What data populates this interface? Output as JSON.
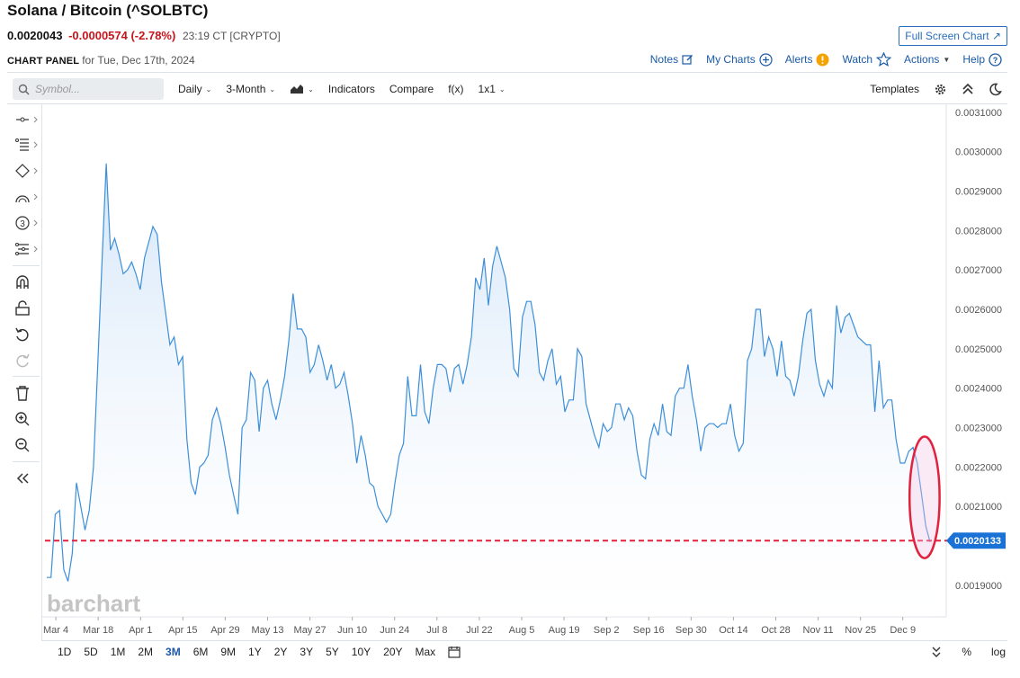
{
  "header": {
    "title": "Solana / Bitcoin (^SOLBTC)",
    "price": "0.0020043",
    "change": "-0.0000574 (-2.78%)",
    "time": "23:19 CT [CRYPTO]",
    "fullscreen_label": "Full Screen Chart ↗",
    "panel_label": "CHART PANEL",
    "panel_date": "for Tue, Dec 17th, 2024"
  },
  "top_links": {
    "notes": "Notes",
    "my_charts": "My Charts",
    "alerts": "Alerts",
    "watch": "Watch",
    "actions": "Actions",
    "help": "Help"
  },
  "toolbar": {
    "search_placeholder": "Symbol...",
    "interval": "Daily",
    "range": "3-Month",
    "indicators": "Indicators",
    "compare": "Compare",
    "fx": "f(x)",
    "layout": "1x1",
    "templates": "Templates"
  },
  "bottom_ranges": [
    "1D",
    "5D",
    "1M",
    "2M",
    "3M",
    "6M",
    "9M",
    "1Y",
    "2Y",
    "3Y",
    "5Y",
    "10Y",
    "20Y",
    "Max"
  ],
  "active_range": "3M",
  "bottom_right": {
    "percent": "%",
    "log": "log"
  },
  "watermark": "barchart",
  "colors": {
    "line": "#3d8fd9",
    "fill": "#d9eafb",
    "price_line": "#e0223f",
    "badge": "#1b72d6",
    "highlight": "#e0223f"
  },
  "chart_data": {
    "type": "area",
    "title": "",
    "xlabel": "",
    "ylabel": "",
    "ylim": [
      0.00182,
      0.00312
    ],
    "y_ticks": [
      "0.0031000",
      "0.0030000",
      "0.0029000",
      "0.0028000",
      "0.0027000",
      "0.0026000",
      "0.0025000",
      "0.0024000",
      "0.0023000",
      "0.0022000",
      "0.0021000",
      "0.0020133",
      "0.0019000"
    ],
    "y_tick_values": [
      0.0031,
      0.003,
      0.0029,
      0.0028,
      0.0027,
      0.0026,
      0.0025,
      0.0024,
      0.0023,
      0.0022,
      0.0021,
      0.0019
    ],
    "x_ticks": [
      {
        "label": "Mar 4",
        "day": 3
      },
      {
        "label": "Mar 18",
        "day": 17
      },
      {
        "label": "Apr 1",
        "day": 31
      },
      {
        "label": "Apr 15",
        "day": 45
      },
      {
        "label": "Apr 29",
        "day": 59
      },
      {
        "label": "May 13",
        "day": 73
      },
      {
        "label": "May 27",
        "day": 87
      },
      {
        "label": "Jun 10",
        "day": 101
      },
      {
        "label": "Jun 24",
        "day": 115
      },
      {
        "label": "Jul 8",
        "day": 129
      },
      {
        "label": "Jul 22",
        "day": 143
      },
      {
        "label": "Aug 5",
        "day": 157
      },
      {
        "label": "Aug 19",
        "day": 171
      },
      {
        "label": "Sep 2",
        "day": 185
      },
      {
        "label": "Sep 16",
        "day": 199
      },
      {
        "label": "Sep 30",
        "day": 213
      },
      {
        "label": "Oct 14",
        "day": 227
      },
      {
        "label": "Oct 28",
        "day": 241
      },
      {
        "label": "Nov 11",
        "day": 255
      },
      {
        "label": "Nov 25",
        "day": 269
      },
      {
        "label": "Dec 9",
        "day": 283
      }
    ],
    "x_range": [
      0,
      292
    ],
    "last_price_label": "0.0020133",
    "last_price": 0.0020133,
    "highlight_day_range": [
      287,
      291
    ],
    "series": [
      {
        "values": [
          0.00192,
          0.00192,
          0.00208,
          0.00209,
          0.00194,
          0.00191,
          0.00198,
          0.00216,
          0.0021,
          0.00204,
          0.00209,
          0.0022,
          0.00246,
          0.00272,
          0.00297,
          0.00275,
          0.00278,
          0.00274,
          0.00269,
          0.0027,
          0.00272,
          0.00269,
          0.00265,
          0.00273,
          0.00277,
          0.00281,
          0.00279,
          0.00267,
          0.00259,
          0.00251,
          0.00253,
          0.00246,
          0.00248,
          0.00227,
          0.00216,
          0.00213,
          0.0022,
          0.00221,
          0.00223,
          0.00232,
          0.00235,
          0.00231,
          0.00225,
          0.00218,
          0.00213,
          0.00208,
          0.0023,
          0.00232,
          0.00244,
          0.00242,
          0.00229,
          0.0024,
          0.00242,
          0.00236,
          0.00232,
          0.00237,
          0.00243,
          0.00252,
          0.00264,
          0.00255,
          0.00255,
          0.00253,
          0.00244,
          0.00246,
          0.00251,
          0.00247,
          0.00242,
          0.00246,
          0.0024,
          0.00241,
          0.00244,
          0.00238,
          0.00231,
          0.00221,
          0.00228,
          0.00223,
          0.00216,
          0.00215,
          0.0021,
          0.00208,
          0.00206,
          0.00208,
          0.00216,
          0.00223,
          0.00226,
          0.00243,
          0.00233,
          0.00233,
          0.00246,
          0.00234,
          0.00231,
          0.0024,
          0.00246,
          0.00246,
          0.00245,
          0.00239,
          0.00245,
          0.00246,
          0.00241,
          0.00246,
          0.00253,
          0.00268,
          0.00265,
          0.00273,
          0.00261,
          0.00271,
          0.00276,
          0.00272,
          0.00268,
          0.0026,
          0.00245,
          0.00243,
          0.00258,
          0.00262,
          0.00262,
          0.00256,
          0.00244,
          0.00242,
          0.00247,
          0.0025,
          0.00241,
          0.00243,
          0.00234,
          0.00237,
          0.00237,
          0.0025,
          0.00248,
          0.00236,
          0.00232,
          0.00228,
          0.00225,
          0.00231,
          0.00229,
          0.0023,
          0.00236,
          0.00236,
          0.00232,
          0.00235,
          0.00233,
          0.00224,
          0.00218,
          0.00217,
          0.00227,
          0.00231,
          0.00228,
          0.00236,
          0.00229,
          0.00228,
          0.00238,
          0.0024,
          0.0024,
          0.00246,
          0.00238,
          0.00232,
          0.00224,
          0.0023,
          0.00231,
          0.00231,
          0.0023,
          0.00231,
          0.00231,
          0.00236,
          0.00228,
          0.00224,
          0.00226,
          0.00247,
          0.0025,
          0.0026,
          0.0026,
          0.00248,
          0.00253,
          0.0025,
          0.00243,
          0.00252,
          0.00243,
          0.00242,
          0.00238,
          0.00243,
          0.00252,
          0.00259,
          0.0026,
          0.00247,
          0.00241,
          0.00238,
          0.00242,
          0.0024,
          0.00261,
          0.00254,
          0.00258,
          0.00259,
          0.00256,
          0.00253,
          0.00252,
          0.00251,
          0.00251,
          0.00234,
          0.00247,
          0.00235,
          0.00237,
          0.00237,
          0.00227,
          0.00221,
          0.00221,
          0.00224,
          0.00225,
          0.00221,
          0.00213,
          0.00205,
          0.00201
        ]
      }
    ]
  }
}
